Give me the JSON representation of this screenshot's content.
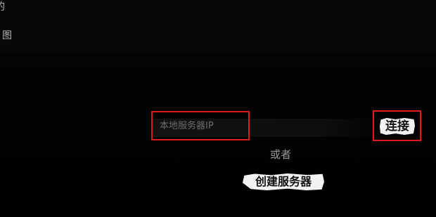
{
  "header": {
    "line1": "的",
    "line2": "图"
  },
  "server_form": {
    "ip_placeholder": "本地服务器IP",
    "ip_value": "",
    "connect_label": "连接",
    "or_label": "或者",
    "create_server_label": "创建服务器"
  },
  "colors": {
    "background": "#000000",
    "highlight_frame": "#e01a1a",
    "button_bg": "#f2f2f2",
    "button_text": "#111111",
    "muted_text": "#9a9a9a"
  }
}
